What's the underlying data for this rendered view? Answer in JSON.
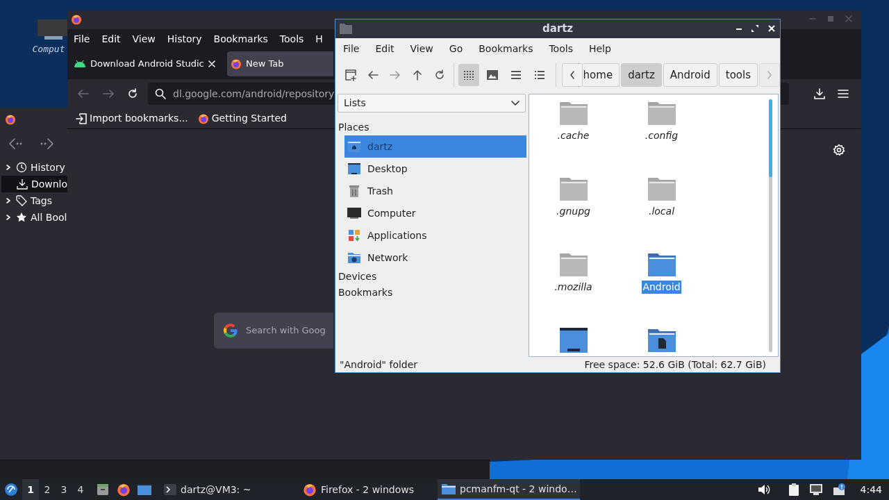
{
  "desktop": {
    "icons": [
      {
        "label": "Comput"
      }
    ]
  },
  "library_window": {
    "tree": [
      {
        "label": "History",
        "kind": "history",
        "expandable": true,
        "selected": false
      },
      {
        "label": "Downlo",
        "kind": "downloads",
        "expandable": false,
        "selected": true
      },
      {
        "label": "Tags",
        "kind": "tags",
        "expandable": true,
        "selected": false
      },
      {
        "label": "All Bool",
        "kind": "bookmarks",
        "expandable": true,
        "selected": false
      }
    ]
  },
  "browser": {
    "menu": [
      "File",
      "Edit",
      "View",
      "History",
      "Bookmarks",
      "Tools",
      "H"
    ],
    "tabs": [
      {
        "label": "Download Android Studic",
        "kind": "android",
        "selected": false
      },
      {
        "label": "New Tab",
        "kind": "firefox",
        "selected": true
      }
    ],
    "url": "dl.google.com/android/repository",
    "bookmarks": [
      {
        "label": "Import bookmarks...",
        "kind": "import"
      },
      {
        "label": "Getting Started",
        "kind": "firefox"
      }
    ],
    "search": {
      "placeholder": "Search with Goog"
    }
  },
  "file_manager": {
    "title": "dartz",
    "menu": [
      "File",
      "Edit",
      "View",
      "Go",
      "Bookmarks",
      "Tools",
      "Help"
    ],
    "view_modes": [
      {
        "kind": "icons",
        "selected": true
      },
      {
        "kind": "thumbnails",
        "selected": false
      },
      {
        "kind": "compact",
        "selected": false
      },
      {
        "kind": "details",
        "selected": false
      }
    ],
    "breadcrumb": [
      {
        "label": "home",
        "selected": false
      },
      {
        "label": "dartz",
        "selected": true
      },
      {
        "label": "Android",
        "selected": false
      },
      {
        "label": "tools",
        "selected": false
      }
    ],
    "side_pane": {
      "dropdown": "Lists",
      "sections": [
        {
          "label": "Places",
          "items": [
            {
              "label": "dartz",
              "kind": "home",
              "selected": true
            },
            {
              "label": "Desktop",
              "kind": "desktop",
              "selected": false
            },
            {
              "label": "Trash",
              "kind": "trash",
              "selected": false
            },
            {
              "label": "Computer",
              "kind": "computer",
              "selected": false
            },
            {
              "label": "Applications",
              "kind": "applications",
              "selected": false
            },
            {
              "label": "Network",
              "kind": "network",
              "selected": false
            }
          ]
        },
        {
          "label": "Devices"
        },
        {
          "label": "Bookmarks"
        }
      ]
    },
    "files": [
      {
        "name": ".cache",
        "kind": "folder",
        "hidden": true,
        "selected": false
      },
      {
        "name": ".config",
        "kind": "folder",
        "hidden": true,
        "selected": false
      },
      {
        "name": ".gnupg",
        "kind": "folder",
        "hidden": true,
        "selected": false
      },
      {
        "name": ".local",
        "kind": "folder",
        "hidden": true,
        "selected": false
      },
      {
        "name": ".mozilla",
        "kind": "folder",
        "hidden": true,
        "selected": false
      },
      {
        "name": "Android",
        "kind": "folder",
        "hidden": false,
        "selected": true
      },
      {
        "kind": "desktop-folder"
      },
      {
        "kind": "documents-folder"
      }
    ],
    "status": {
      "left": "\"Android\" folder",
      "right": "Free space: 52.6 GiB (Total: 62.7 GiB)"
    }
  },
  "taskbar": {
    "workspaces": [
      {
        "label": "1",
        "selected": true
      },
      {
        "label": "2",
        "selected": false
      },
      {
        "label": "3",
        "selected": false
      },
      {
        "label": "4",
        "selected": false
      }
    ],
    "tasks": [
      {
        "label": "dartz@VM3: ~",
        "kind": "terminal",
        "selected": false
      },
      {
        "label": "Firefox - 2 windows",
        "kind": "firefox",
        "selected": false
      },
      {
        "label": "pcmanfm-qt - 2 windo…",
        "kind": "folder",
        "selected": true
      }
    ],
    "clock": "4:44"
  }
}
